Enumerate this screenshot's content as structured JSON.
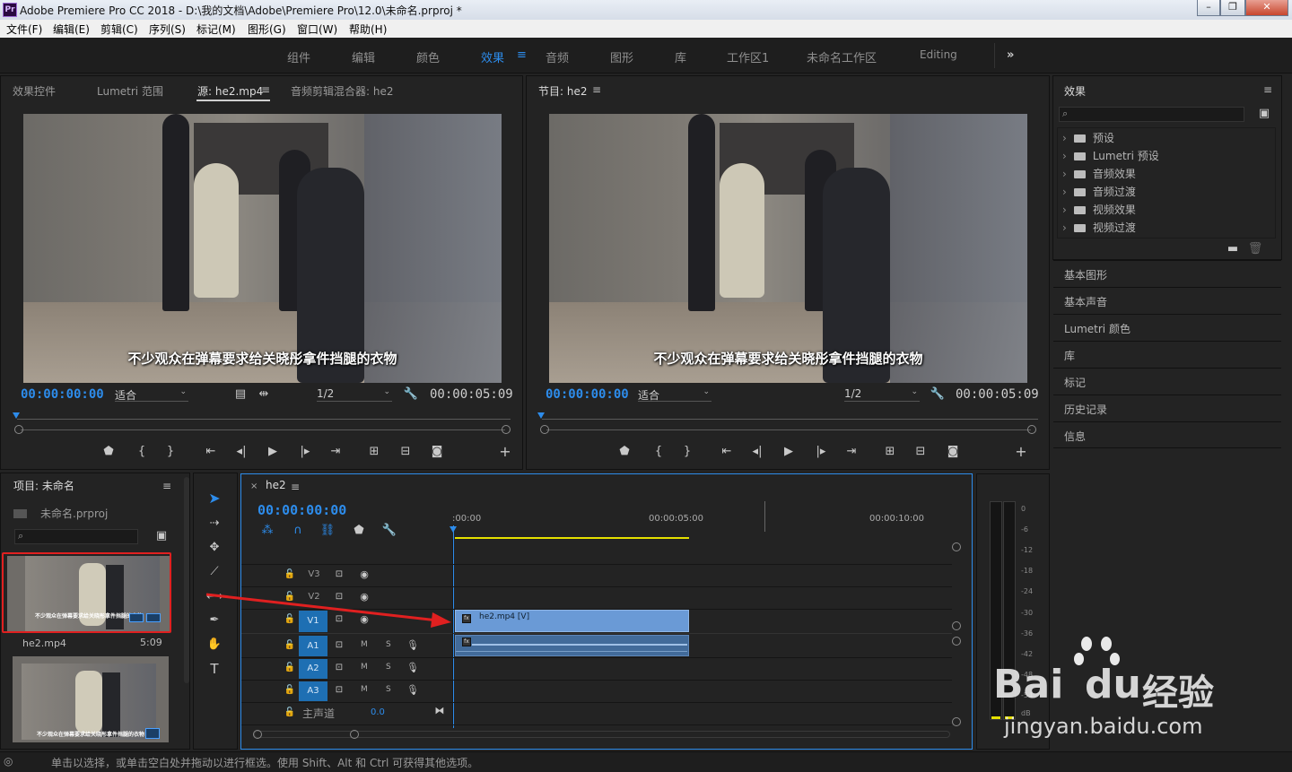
{
  "window": {
    "title": "Adobe Premiere Pro CC 2018 - D:\\我的文档\\Adobe\\Premiere Pro\\12.0\\未命名.prproj *",
    "app_icon": "Pr"
  },
  "menu": [
    "文件(F)",
    "编辑(E)",
    "剪辑(C)",
    "序列(S)",
    "标记(M)",
    "图形(G)",
    "窗口(W)",
    "帮助(H)"
  ],
  "workspaces": [
    "组件",
    "编辑",
    "颜色",
    "效果",
    "音频",
    "图形",
    "库",
    "工作区1",
    "未命名工作区",
    "Editing"
  ],
  "active_workspace": "效果",
  "source_panel": {
    "tabs": [
      "效果控件",
      "Lumetri 范围",
      "源: he2.mp4",
      "音频剪辑混合器: he2"
    ],
    "active_tab": "源: he2.mp4",
    "subtitle": "不少观众在弹幕要求给关晓彤拿件挡腿的衣物",
    "timecode": "00:00:00:00",
    "fit": "适合",
    "resolution": "1/2",
    "duration": "00:00:05:09"
  },
  "program_panel": {
    "tab": "节目: he2",
    "subtitle": "不少观众在弹幕要求给关晓彤拿件挡腿的衣物",
    "timecode": "00:00:00:00",
    "fit": "适合",
    "resolution": "1/2",
    "duration": "00:00:05:09"
  },
  "effects_panel": {
    "title": "效果",
    "items": [
      "预设",
      "Lumetri 预设",
      "音频效果",
      "音频过渡",
      "视频效果",
      "视频过渡"
    ]
  },
  "side_panels": [
    "基本图形",
    "基本声音",
    "Lumetri 颜色",
    "库",
    "标记",
    "历史记录",
    "信息"
  ],
  "project_panel": {
    "title": "项目: 未命名",
    "file": "未命名.prproj",
    "clip_name": "he2.mp4",
    "clip_duration": "5:09",
    "thumb_caption": "不少观众在弹幕要求给关晓彤拿件挡腿的衣物"
  },
  "timeline": {
    "sequence": "he2",
    "timecode": "00:00:00:00",
    "ruler": [
      ":00:00",
      "00:00:05:00",
      "00:00:10:00"
    ],
    "tracks": {
      "video": [
        "V3",
        "V2",
        "V1"
      ],
      "audio": [
        "A1",
        "A2",
        "A3"
      ],
      "master": "主声道",
      "master_value": "0.0"
    },
    "track_buttons": {
      "mute": "M",
      "solo": "S"
    },
    "video_clip": "he2.mp4 [V]",
    "clip_icon": "fx"
  },
  "meter": {
    "labels": [
      "0",
      "-6",
      "-12",
      "-18",
      "-24",
      "-30",
      "-36",
      "-42",
      "-48",
      "-54",
      "dB"
    ]
  },
  "status_bar": "单击以选择，或单击空白处并拖动以进行框选。使用 Shift、Alt 和 Ctrl 可获得其他选项。",
  "watermark": {
    "brand": "Bai",
    "brand2": "du",
    "cn": "经验",
    "url": "jingyan.baidu.com"
  },
  "colors": {
    "accent": "#2d8ceb",
    "highlight_box": "#e02020",
    "arrow": "#e02020",
    "clip_video": "#6a9ad6"
  }
}
